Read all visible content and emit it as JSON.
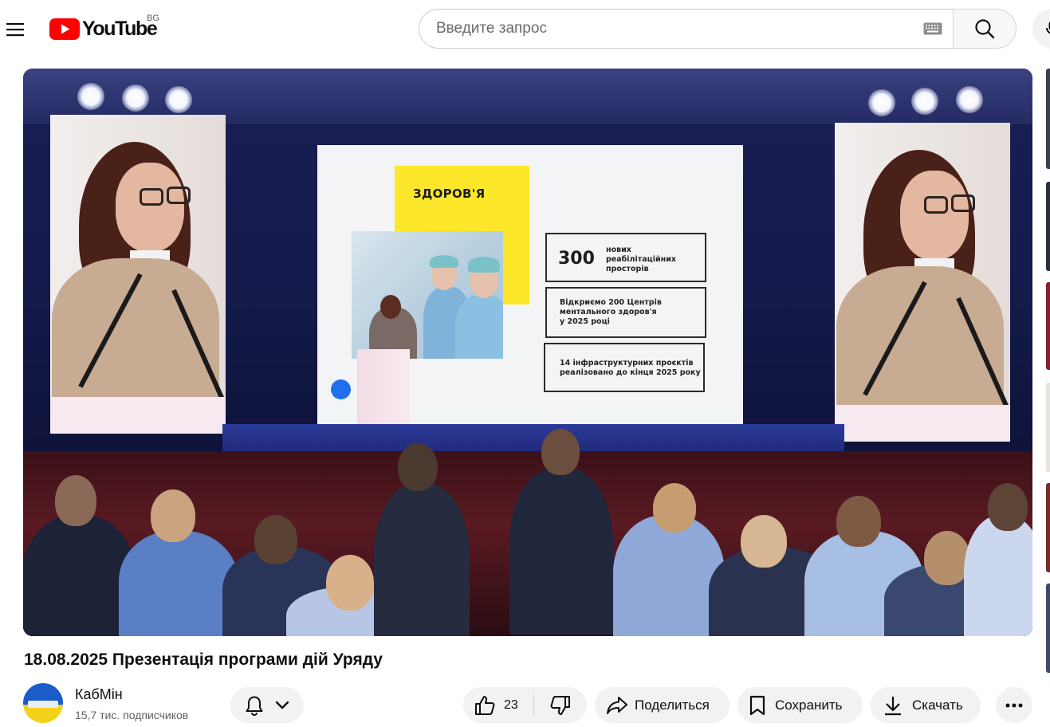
{
  "header": {
    "logo_text": "YouTube",
    "region_code": "BG",
    "search": {
      "placeholder": "Введите запрос",
      "value": ""
    }
  },
  "video": {
    "slide": {
      "title": "ЗДОРОВ'Я",
      "stat_number": "300",
      "stat_text_lines": [
        "нових",
        "реабілітаційних",
        "просторів"
      ],
      "box2_lines": [
        "Відкриємо 200 Центрів",
        "ментального здоров'я",
        "у 2025 році"
      ],
      "box3_lines": [
        "14 інфраструктурних проєктів",
        "реалізовано до кінця 2025 року"
      ]
    },
    "title": "18.08.2025 Презентація програми дій Уряду"
  },
  "owner": {
    "channel_name": "КабМін",
    "subscribers": "15,7 тис. подписчиков"
  },
  "actions": {
    "like_count": "23",
    "share_label": "Поделиться",
    "save_label": "Сохранить",
    "download_label": "Скачать"
  },
  "icons": {
    "menu": "menu-icon",
    "logo": "youtube-logo-icon",
    "keyboard": "keyboard-icon",
    "search": "search-icon",
    "mic": "mic-icon",
    "bell": "bell-icon",
    "chevron": "chevron-down-icon",
    "like": "thumbs-up-icon",
    "dislike": "thumbs-down-icon",
    "share": "share-icon",
    "save": "bookmark-icon",
    "download": "download-icon",
    "more": "more-horizontal-icon"
  },
  "colors": {
    "brand_red": "#ff0000",
    "slide_yellow": "#fde72b",
    "button_bg": "#f2f2f2",
    "text_secondary": "#606060"
  }
}
